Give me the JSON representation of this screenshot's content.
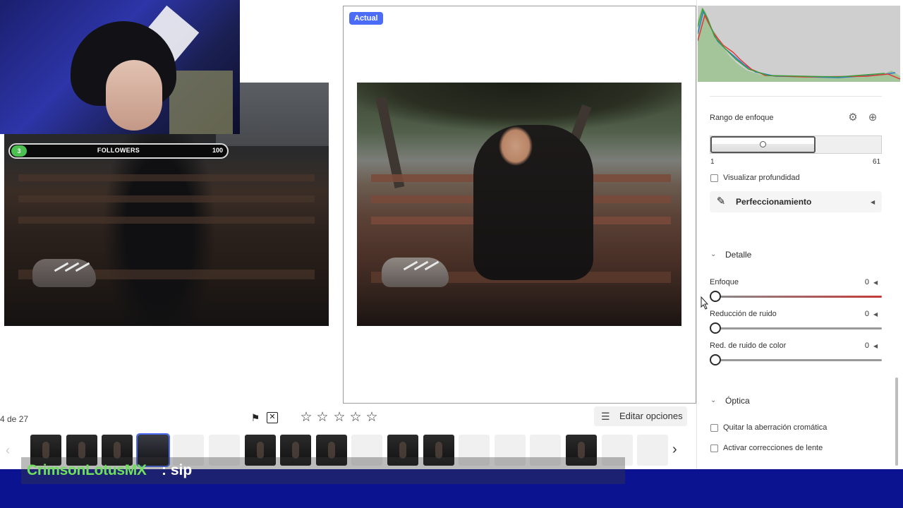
{
  "compare": {
    "after_badge": "Actual"
  },
  "webcam": {
    "followers_current": "3",
    "followers_label": "FOLLOWERS",
    "followers_goal": "100"
  },
  "toolbar": {
    "counter": "4 de 27",
    "rating_stars": 5,
    "edit_options_label": "Editar opciones"
  },
  "filmstrip": {
    "thumbnails": [
      "dark",
      "dark",
      "dark",
      "selected",
      "light",
      "light",
      "dark",
      "dark",
      "dark",
      "light",
      "dark",
      "dark",
      "light",
      "light",
      "light",
      "dark",
      "light",
      "light"
    ]
  },
  "panel": {
    "focus_range": {
      "label": "Rango de enfoque",
      "min": "1",
      "max": "61"
    },
    "depth_checkbox": "Visualizar profundidad",
    "refine_label": "Perfeccionamiento",
    "detail": {
      "title": "Detalle",
      "sliders": [
        {
          "label": "Enfoque",
          "value": "0"
        },
        {
          "label": "Reducción de ruido",
          "value": "0"
        },
        {
          "label": "Red. de ruido de color",
          "value": "0"
        }
      ]
    },
    "optics": {
      "title": "Óptica",
      "options": [
        "Quitar la aberración cromática",
        "Activar correcciones de lente"
      ]
    }
  },
  "chat": {
    "username": "CrimsonLotusMX",
    "message": " : sip"
  },
  "colors": {
    "accent": "#4a6cf7",
    "stream_band": "#0b1390",
    "chat_user": "#6fe05c"
  }
}
